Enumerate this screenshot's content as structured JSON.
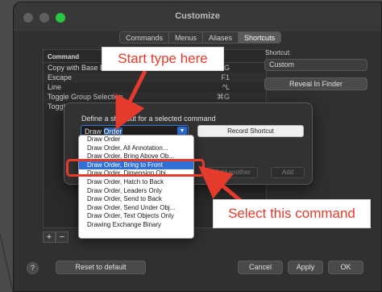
{
  "window": {
    "title": "Customize"
  },
  "tabs": [
    {
      "label": "Commands",
      "active": false
    },
    {
      "label": "Menus",
      "active": false
    },
    {
      "label": "Aliases",
      "active": false
    },
    {
      "label": "Shortcuts",
      "active": true
    }
  ],
  "command_table": {
    "header": "Command",
    "rows": [
      {
        "command": "Copy with Base Point",
        "shortcut": "⌘G"
      },
      {
        "command": "Escape",
        "shortcut": "F1"
      },
      {
        "command": "Line",
        "shortcut": "^L"
      },
      {
        "command": "Toggle Group Selection",
        "shortcut": "⌘G"
      },
      {
        "command": "Toggle Ortho",
        "shortcut": ""
      }
    ]
  },
  "shortcut_panel": {
    "label": "Shortcut:",
    "selected": "Custom",
    "reveal_label": "Reveal In Finder"
  },
  "table_buttons": {
    "plus": "+",
    "minus": "−"
  },
  "footer": {
    "help": "?",
    "reset": "Reset to default",
    "cancel": "Cancel",
    "apply": "Apply",
    "ok": "OK"
  },
  "sheet": {
    "label": "Define a shortcut for a selected command",
    "combo_prefix": "Draw ",
    "combo_selected_text": "Order",
    "record_label": "Record Shortcut",
    "add_another_label": "Add another",
    "add_label": "Add"
  },
  "dropdown": {
    "selected_index": 3,
    "items": [
      "Draw Order",
      "Draw Order, All Annotation...",
      "Draw Order, Bring Above Ob...",
      "Draw Order, Bring to Front",
      "Draw Order, Dimension Obj...",
      "Draw Order, Hatch to Back",
      "Draw Order, Leaders Only",
      "Draw Order, Send to Back",
      "Draw Order, Send Under Obj...",
      "Draw Order, Text Objects Only",
      "Drawing Exchange Binary"
    ]
  },
  "callouts": {
    "start": "Start type here",
    "select": "Select this command",
    "color": "#e53b2c"
  },
  "icons": {
    "combo_arrow": "chevron-down-icon",
    "help": "help-icon"
  }
}
